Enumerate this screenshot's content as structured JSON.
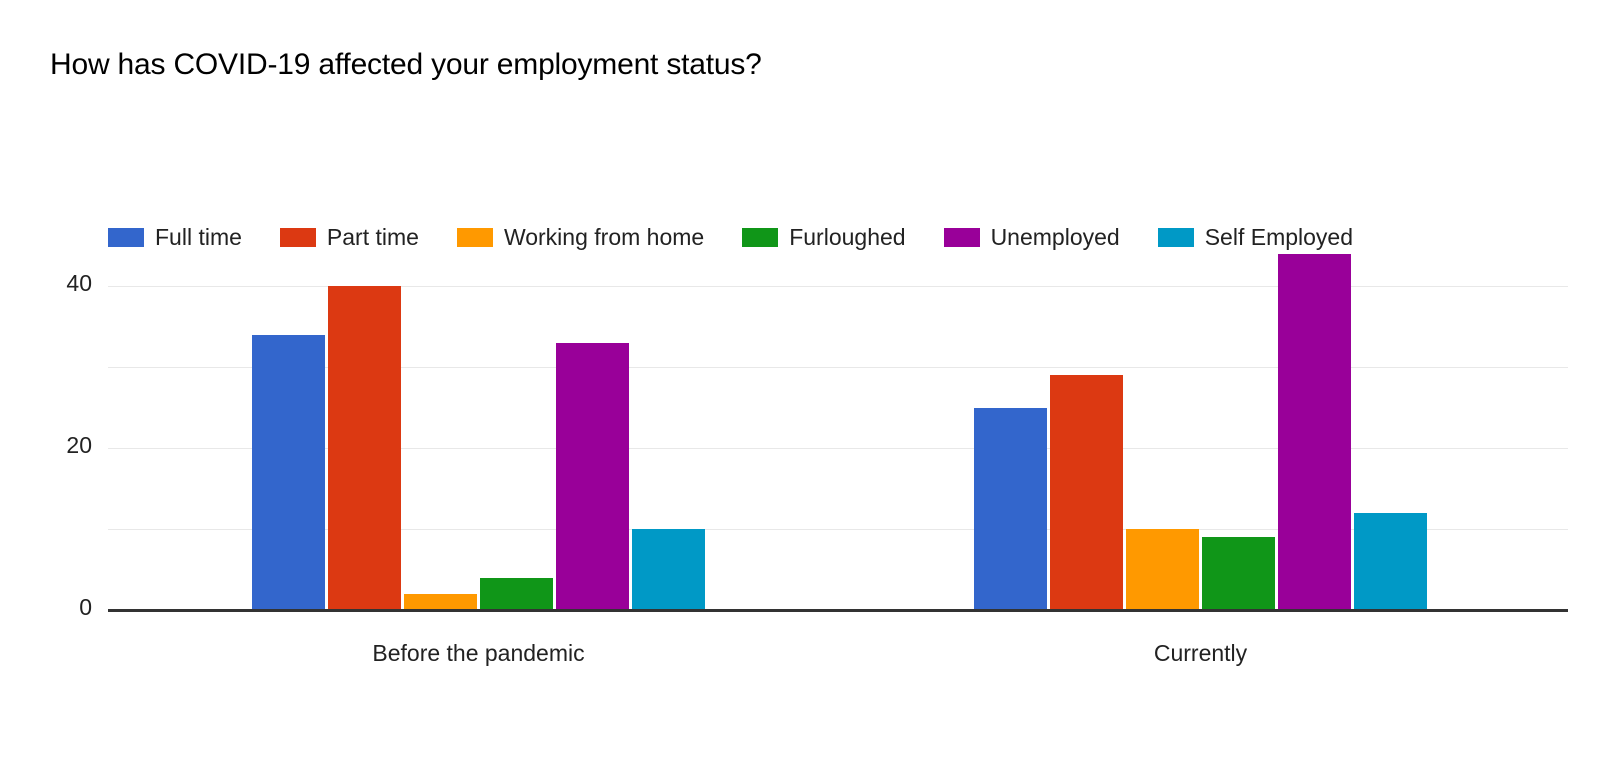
{
  "chart_data": {
    "type": "bar",
    "title": "How has COVID-19 affected your employment status?",
    "subtitle": "",
    "xlabel": "",
    "ylabel": "",
    "categories": [
      "Before the pandemic",
      "Currently"
    ],
    "series": [
      {
        "name": "Full time",
        "color": "#3366CC",
        "values": [
          34,
          25
        ]
      },
      {
        "name": "Part time",
        "color": "#DC3912",
        "values": [
          40,
          29
        ]
      },
      {
        "name": "Working from home",
        "color": "#FF9900",
        "values": [
          2,
          10
        ]
      },
      {
        "name": "Furloughed",
        "color": "#109618",
        "values": [
          4,
          9
        ]
      },
      {
        "name": "Unemployed",
        "color": "#990099",
        "values": [
          33,
          44
        ]
      },
      {
        "name": "Self Employed",
        "color": "#0099C6",
        "values": [
          10,
          12
        ]
      }
    ],
    "ylim": [
      0,
      40
    ],
    "y_axis_max_render": 40,
    "yticks": [
      0,
      20,
      40
    ],
    "ytick_labels": [
      "0",
      "20",
      "40"
    ],
    "gridlines": [
      0,
      10,
      20,
      30,
      40
    ],
    "grid": true,
    "legend_position": "top",
    "background_color": "#FFFFFF",
    "gridline_color": "#E8E8E8",
    "baseline_color": "#333333"
  },
  "legend": {
    "items": [
      {
        "label": "Full time"
      },
      {
        "label": "Part time"
      },
      {
        "label": "Working from home"
      },
      {
        "label": "Furloughed"
      },
      {
        "label": "Unemployed"
      },
      {
        "label": "Self Employed"
      }
    ]
  },
  "axis": {
    "y_labels": [
      "40",
      "20",
      "0"
    ],
    "x_labels": [
      "Before the pandemic",
      "Currently"
    ]
  }
}
